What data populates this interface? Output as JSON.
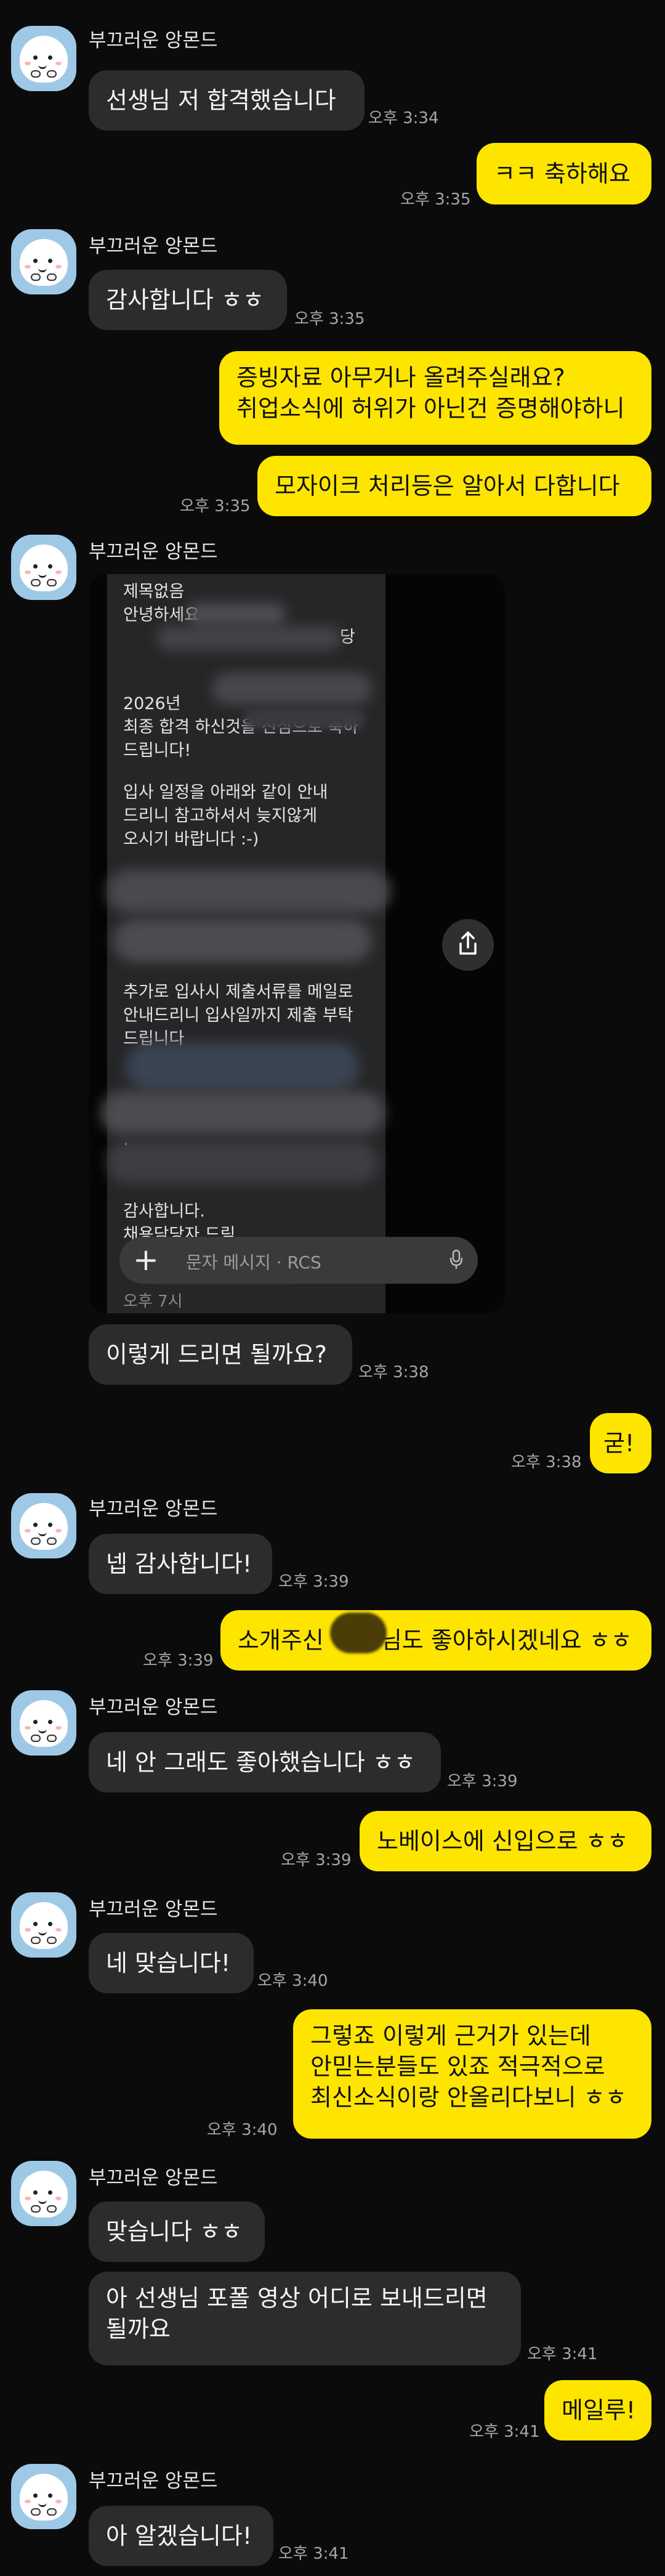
{
  "sender": {
    "name": "부끄러운 앙몬드"
  },
  "messages": [
    {
      "text": "선생님 저 합격했습니다",
      "time": "오후 3:34"
    },
    {
      "text": "ㅋㅋ 축하해요",
      "time": "오후 3:35"
    },
    {
      "text": "감사합니다 ㅎㅎ",
      "time": "오후 3:35"
    },
    {
      "lines": [
        "증빙자료 아무거나 올려주실래요?",
        "취업소식에 허위가 아닌건 증명해야하니"
      ]
    },
    {
      "text": "모자이크 처리등은 알아서 다합니다",
      "time": "오후 3:35"
    },
    {
      "text": "이렇게 드리면 될까요?",
      "time": "오후 3:38"
    },
    {
      "text": "굳!",
      "time": "오후 3:38"
    },
    {
      "text": "넵 감사합니다!",
      "time": "오후 3:39"
    },
    {
      "before": "소개주신",
      "after": "님도 좋아하시겠네요 ㅎㅎ",
      "time": "오후 3:39"
    },
    {
      "text": "네 안 그래도 좋아했습니다 ㅎㅎ",
      "time": "오후 3:39"
    },
    {
      "text": "노베이스에 신입으로 ㅎㅎ",
      "time": "오후 3:39"
    },
    {
      "text": "네 맞습니다!",
      "time": "오후 3:40"
    },
    {
      "lines": [
        "그렇죠 이렇게 근거가 있는데",
        "안믿는분들도 있죠 적극적으로",
        "최신소식이랑 안올리다보니 ㅎㅎ"
      ],
      "time": "오후 3:40"
    },
    {
      "text": "맞습니다 ㅎㅎ"
    },
    {
      "lines": [
        "아 선생님 포폴 영상 어디로 보내드리면",
        "될까요"
      ],
      "time": "오후 3:41"
    },
    {
      "text": "메일루!",
      "time": "오후 3:41"
    },
    {
      "text": "아 알겠습니다!",
      "time": "오후 3:41"
    }
  ],
  "screenshot": {
    "subject": "제목없음",
    "greeting": "안녕하세요",
    "partial_right": "당",
    "year": "2026년",
    "line_final": "최종 합격 하신것을 진심으로 축하",
    "line_congrats_end": "드립니다!",
    "schedule_1": "입사 일정을 아래와 같이 안내",
    "schedule_2": "드리니 참고하셔서 늦지않게",
    "schedule_3": "오시기 바랍니다 :-)",
    "extra_1": "추가로 입사시 제출서류를 메일로",
    "extra_2": "안내드리니 입사일까지 제출 부탁",
    "extra_3": "드립니다",
    "dot": ".",
    "thanks": "감사합니다.",
    "signature": "채용담당자 드림",
    "partial_bottom": "오후 7시",
    "input_placeholder": "문자 메시지 · RCS",
    "input_plus": "+"
  },
  "icons": {
    "share": "share-icon",
    "mic": "microphone-icon",
    "avatar": "avatar-character"
  },
  "colors": {
    "background": "#0b0b0b",
    "incoming_bubble": "#2c2c2c",
    "outgoing_bubble": "#fee500"
  }
}
